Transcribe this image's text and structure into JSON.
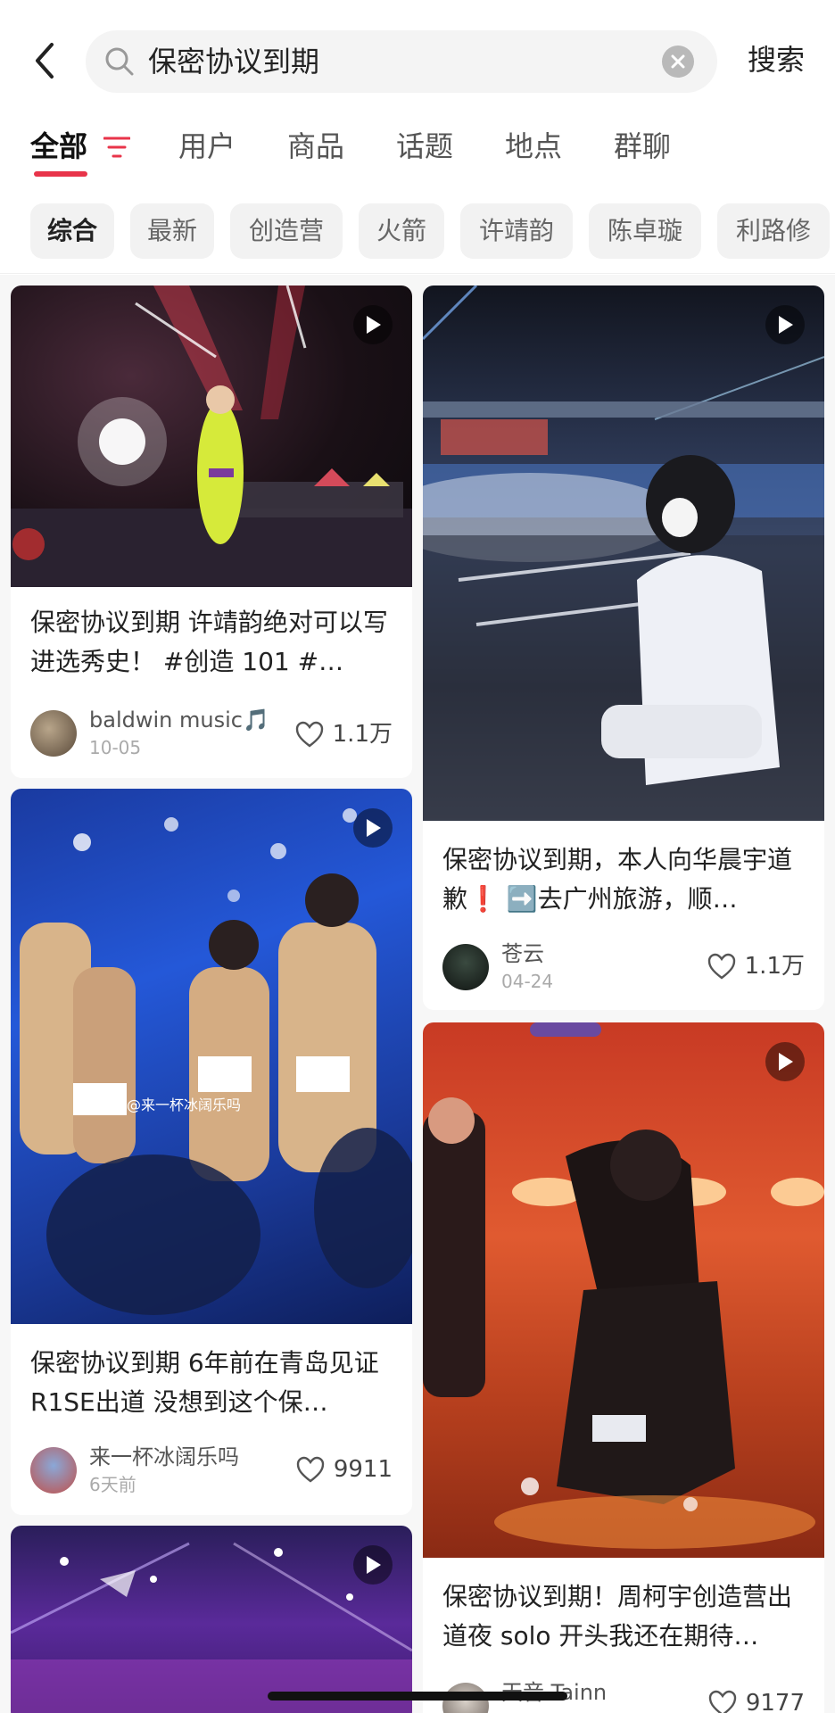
{
  "search": {
    "query": "保密协议到期",
    "submit_label": "搜索"
  },
  "tabs": [
    {
      "label": "全部"
    },
    {
      "label": "用户"
    },
    {
      "label": "商品"
    },
    {
      "label": "话题"
    },
    {
      "label": "地点"
    },
    {
      "label": "群聊"
    }
  ],
  "chips": [
    {
      "label": "综合"
    },
    {
      "label": "最新"
    },
    {
      "label": "创造营"
    },
    {
      "label": "火箭"
    },
    {
      "label": "许靖韵"
    },
    {
      "label": "陈卓璇"
    },
    {
      "label": "利路修"
    }
  ],
  "colors": {
    "accent": "#e8344a"
  },
  "posts": [
    {
      "title": "保密协议到期 许靖韵绝对可以写进选秀史！ #创造 101 #…",
      "author": "baldwin music🎵",
      "date": "10-05",
      "likes": "1.1万",
      "media": "video"
    },
    {
      "title": "保密协议到期，本人向华晨宇道歉❗ ➡️去广州旅游，顺…",
      "author": "苍云",
      "date": "04-24",
      "likes": "1.1万",
      "media": "video"
    },
    {
      "title": "保密协议到期 6年前在青岛见证R1SE出道 没想到这个保…",
      "author": "来一杯冰阔乐吗",
      "date": "6天前",
      "likes": "9911",
      "media": "video",
      "watermark": "@来一杯冰阔乐吗"
    },
    {
      "title": "保密协议到期！周柯宇创造营出道夜 solo 开头我还在期待…",
      "author": "天音 Tainn",
      "date": "",
      "likes": "9177",
      "media": "video"
    },
    {
      "title": "",
      "author": "",
      "date": "",
      "likes": "",
      "media": "video"
    }
  ]
}
